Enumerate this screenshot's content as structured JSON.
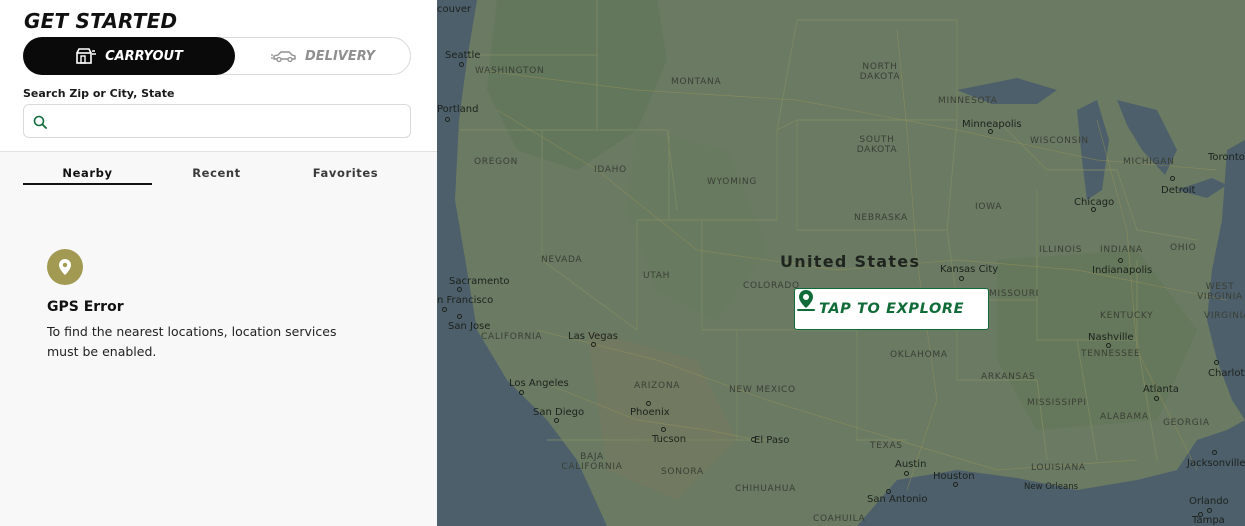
{
  "header": {
    "title": "GET STARTED"
  },
  "order_toggle": {
    "carryout_label": "CARRYOUT",
    "delivery_label": "DELIVERY",
    "selected": "CARRYOUT",
    "carryout_icon": "carryout-store-icon",
    "delivery_icon": "delivery-car-icon"
  },
  "search": {
    "label": "Search Zip or City, State",
    "value": "",
    "placeholder": "",
    "icon": "search-icon"
  },
  "tabs": [
    {
      "label": "Nearby",
      "active": true
    },
    {
      "label": "Recent",
      "active": false
    },
    {
      "label": "Favorites",
      "active": false
    }
  ],
  "gps_error": {
    "icon": "location-pin-icon",
    "title": "GPS Error",
    "message": "To find the nearest locations, location services must be enabled."
  },
  "map": {
    "country_label": "United States",
    "explore_button": "TAP TO EXPLORE",
    "explore_icon": "map-pin-icon",
    "state_labels": [
      "WASHINGTON",
      "MONTANA",
      "NORTH DAKOTA",
      "MINNESOTA",
      "OREGON",
      "IDAHO",
      "SOUTH DAKOTA",
      "WISCONSIN",
      "MICHIGAN",
      "WYOMING",
      "IOWA",
      "NEBRASKA",
      "NEVADA",
      "UTAH",
      "ILLINOIS",
      "INDIANA",
      "OHIO",
      "COLORADO",
      "MISSOURI",
      "WEST VIRGINIA",
      "CALIFORNIA",
      "KENTUCKY",
      "OKLAHOMA",
      "TENNESSEE",
      "ARIZONA",
      "NEW MEXICO",
      "ARKANSAS",
      "MISSISSIPPI",
      "ALABAMA",
      "GEORGIA",
      "TEXAS",
      "LOUISIANA",
      "BAJA CALIFORNIA",
      "SONORA",
      "CHIHUAHUA",
      "COAHUILA",
      "VIRGINIA"
    ],
    "city_labels": [
      "couver",
      "Seattle",
      "Portland",
      "Minneapolis",
      "Toronto",
      "Detroit",
      "Chicago",
      "Kansas City",
      "Indianapolis",
      "Sacramento",
      "n Francisco",
      "San Jose",
      "Las Vegas",
      "Nashville",
      "Charlotte",
      "Los Angeles",
      "San Diego",
      "Phoenix",
      "Atlanta",
      "Tucson",
      "El Paso",
      "Jacksonville",
      "Austin",
      "Houston",
      "New Orleans",
      "San Antonio",
      "Orlando",
      "Tampa"
    ]
  },
  "colors": {
    "brand_green": "#116b39",
    "pin_gold": "#a29a52",
    "toggle_active_bg": "#0a0a0a",
    "map_overlay": "#5e6c5b"
  }
}
